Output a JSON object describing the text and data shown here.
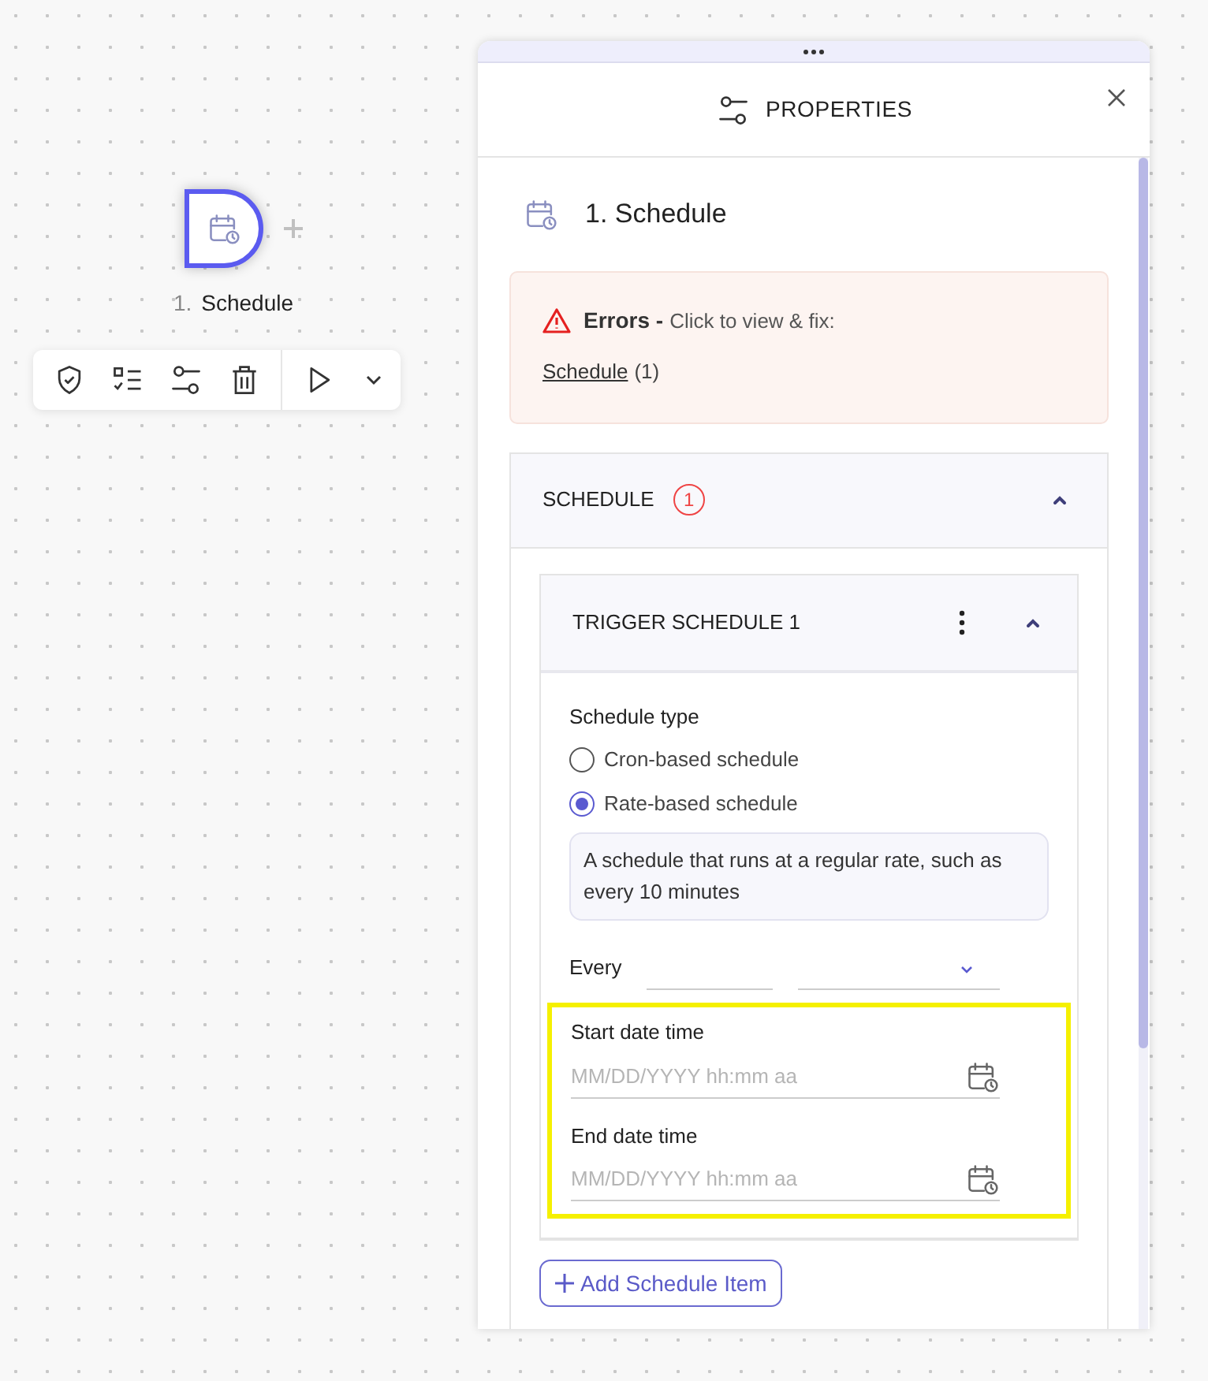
{
  "canvas": {
    "node": {
      "number": "1.",
      "label": "Schedule",
      "selected": true
    }
  },
  "panel": {
    "title": "PROPERTIES",
    "step_title": "1. Schedule",
    "errors": {
      "heading": "Errors -",
      "prompt": "Click to view & fix:",
      "links": [
        {
          "label": "Schedule",
          "count": "(1)"
        }
      ]
    },
    "section": {
      "title": "SCHEDULE",
      "badge": "1",
      "expanded": true,
      "items": [
        {
          "title": "TRIGGER SCHEDULE 1",
          "expanded": true,
          "schedule_type": {
            "label": "Schedule type",
            "options": [
              {
                "label": "Cron-based schedule",
                "selected": false
              },
              {
                "label": "Rate-based schedule",
                "selected": true
              }
            ],
            "description": "A schedule that runs at a regular rate, such as every 10 minutes"
          },
          "every": {
            "label": "Every"
          },
          "date_fields": {
            "highlighted": true,
            "fields": [
              {
                "label": "Start date time",
                "placeholder": "MM/DD/YYYY hh:mm aa"
              },
              {
                "label": "End date time",
                "placeholder": "MM/DD/YYYY hh:mm aa"
              }
            ]
          }
        }
      ],
      "add_button": "Add Schedule Item"
    }
  }
}
